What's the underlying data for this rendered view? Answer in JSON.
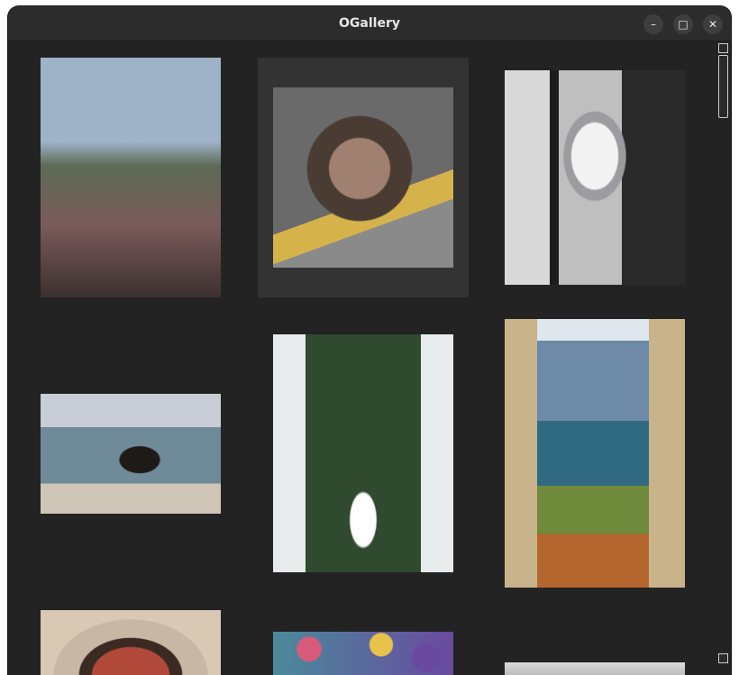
{
  "window": {
    "title": "OGallery",
    "minimize_glyph": "–",
    "maximize_glyph": "□",
    "close_glyph": "✕"
  },
  "gallery": {
    "selected_index": 1,
    "images": [
      {
        "name": "image-window-view-room",
        "colors": [
          "#9fb3c8",
          "#3c3030",
          "#7a5a5a",
          "#2a2222"
        ]
      },
      {
        "name": "image-kittens-in-pot",
        "colors": [
          "#6a6a6a",
          "#4a3b33",
          "#d6b34a",
          "#8a8a8a"
        ]
      },
      {
        "name": "image-husky-puppy-in-camera-bag",
        "colors": [
          "#d9d9d9",
          "#1c1c1c",
          "#bfbfbf",
          "#2a2a2a"
        ]
      },
      {
        "name": "image-person-on-beach",
        "colors": [
          "#c9cdd5",
          "#6f8a99",
          "#1e1a18",
          "#c08a6a"
        ]
      },
      {
        "name": "image-cat-in-window-with-geraniums",
        "colors": [
          "#e8ebec",
          "#2f4a2f",
          "#ffffff",
          "#8a5a3a"
        ]
      },
      {
        "name": "image-open-door-lake-view",
        "colors": [
          "#6d8aa8",
          "#c9b38a",
          "#2f6a82",
          "#b5652e"
        ]
      },
      {
        "name": "image-ornate-arch",
        "colors": [
          "#c9b7a5",
          "#3a2a22",
          "#b0493a",
          "#d8c8b4"
        ]
      },
      {
        "name": "image-colorful-bokeh",
        "colors": [
          "#4a8a9a",
          "#d85a7a",
          "#e8c24a",
          "#6a4aa0"
        ]
      },
      {
        "name": "image-partial-bottom",
        "colors": [
          "#dcdcdc",
          "#cfcfcf",
          "#bcbcbc",
          "#e5e5e5"
        ]
      }
    ]
  }
}
